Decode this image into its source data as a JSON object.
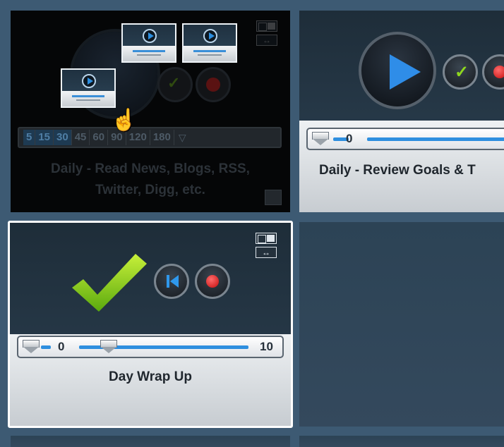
{
  "tiles": [
    {
      "title": "Daily - Read News, Blogs, RSS, Twitter, Digg, etc.",
      "title_line1": "Daily - Read News, Blogs, RSS,",
      "title_line2": "Twitter, Digg, etc.",
      "state": "dragging",
      "time_options": [
        "5",
        "15",
        "30",
        "45",
        "60",
        "90",
        "120",
        "180"
      ],
      "highlighted_options": [
        "5",
        "15",
        "30"
      ]
    },
    {
      "title": "Daily - Review Goals & T",
      "state": "ready",
      "slider_value": "0",
      "play_color": "#2f8de8"
    },
    {
      "title": "Day Wrap Up",
      "state": "completed",
      "slider_min": "0",
      "slider_current": "0",
      "slider_max": "10",
      "check_color": "#8fd81e"
    }
  ],
  "drag_thumbnails_count": 3,
  "colors": {
    "background": "#3d5a73",
    "accent_blue": "#2f8de8",
    "record_red": "#e01b1b",
    "selected_border": "#ffffff"
  },
  "icons": {
    "view_toggle": "layout-toggle-icon",
    "swap": "swap-arrows-icon",
    "cursor": "grab-hand-icon",
    "edit": "edit-icon"
  }
}
